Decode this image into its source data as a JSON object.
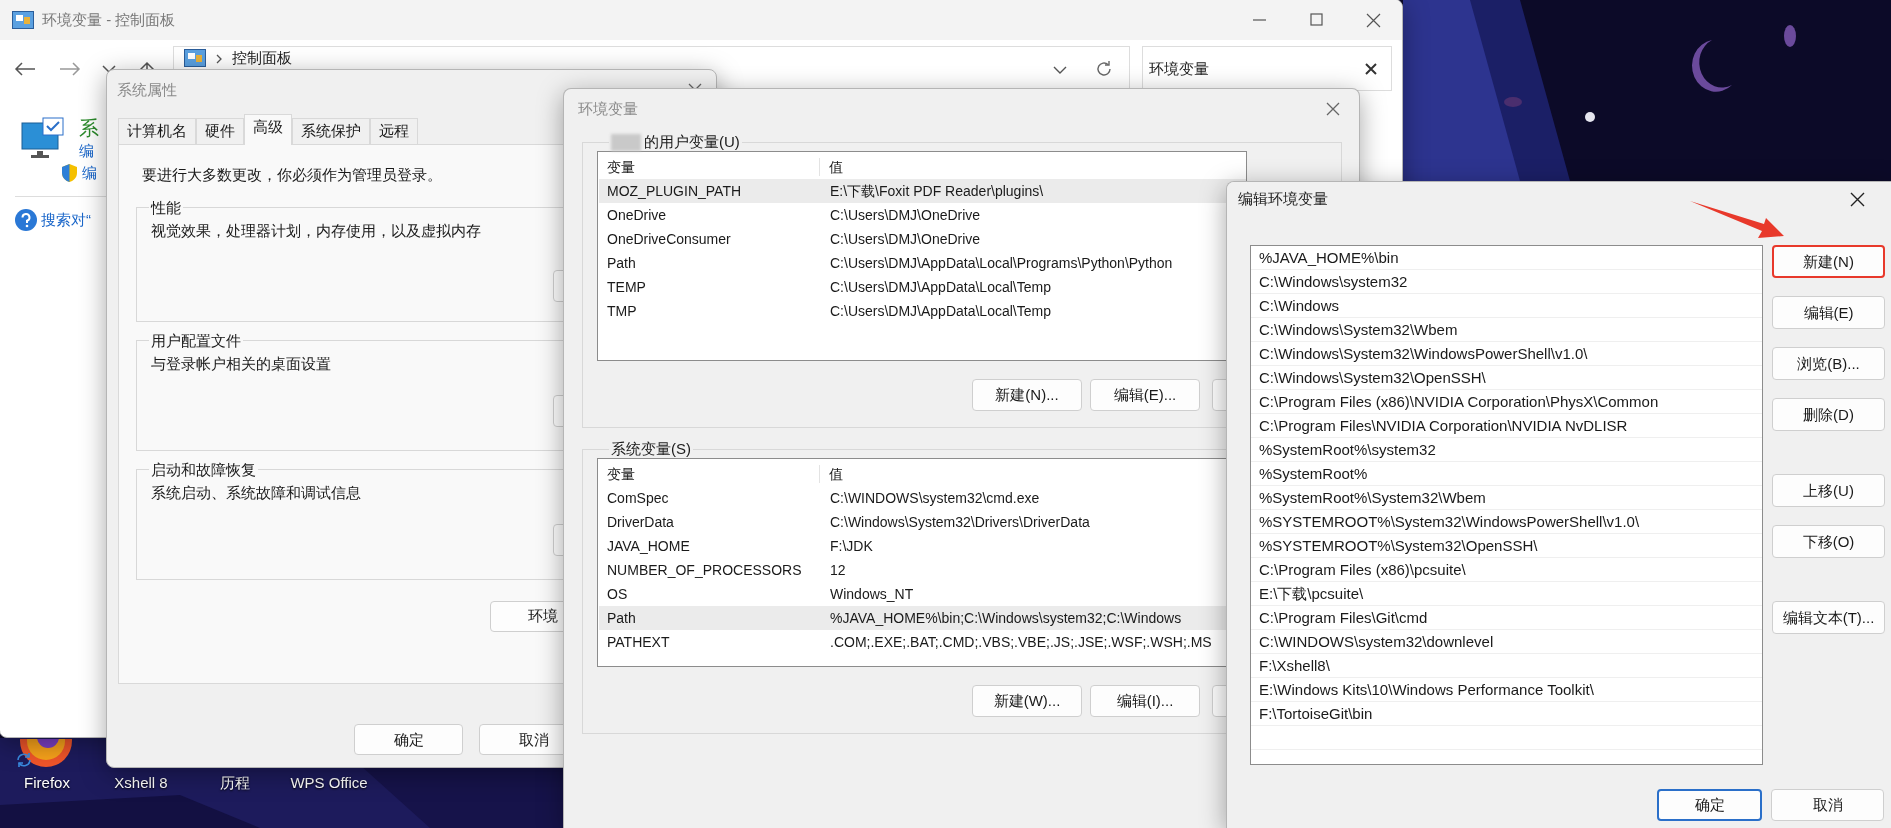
{
  "desktop": {
    "icons": [
      {
        "label": "Firefox"
      },
      {
        "label": "Xshell 8"
      },
      {
        "label": "历程"
      },
      {
        "label": "WPS Office"
      }
    ]
  },
  "control_panel": {
    "title": "环境变量 - 控制面板",
    "breadcrumb": "控制面板",
    "search": {
      "value": "环境变量"
    },
    "side_items": [
      {
        "kind": "title",
        "text": "系"
      },
      {
        "kind": "link",
        "text": "编"
      },
      {
        "kind": "shield_link",
        "text": "编"
      },
      {
        "kind": "help",
        "text": "搜索对“"
      }
    ]
  },
  "system_properties": {
    "title": "系统属性",
    "tabs": [
      {
        "label": "计算机名",
        "selected": false
      },
      {
        "label": "硬件",
        "selected": false
      },
      {
        "label": "高级",
        "selected": true
      },
      {
        "label": "系统保护",
        "selected": false
      },
      {
        "label": "远程",
        "selected": false
      }
    ],
    "notice": "要进行大多数更改，你必须作为管理员登录。",
    "groups": [
      {
        "title": "性能",
        "text": "视觉效果，处理器计划，内存使用，以及虚拟内存"
      },
      {
        "title": "用户配置文件",
        "text": "与登录帐户相关的桌面设置"
      },
      {
        "title": "启动和故障恢复",
        "text": "系统启动、系统故障和调试信息"
      }
    ],
    "env_button": "环境",
    "buttons": [
      "确定",
      "取消"
    ]
  },
  "environment_variables": {
    "title": "环境变量",
    "user_group": "的用户变量(U)",
    "user_table": {
      "columns": [
        "变量",
        "值"
      ],
      "rows": [
        {
          "variable": "MOZ_PLUGIN_PATH",
          "value": "E:\\下载\\Foxit PDF Reader\\plugins\\",
          "selected": true
        },
        {
          "variable": "OneDrive",
          "value": "C:\\Users\\DMJ\\OneDrive",
          "selected": false
        },
        {
          "variable": "OneDriveConsumer",
          "value": "C:\\Users\\DMJ\\OneDrive",
          "selected": false
        },
        {
          "variable": "Path",
          "value": "C:\\Users\\DMJ\\AppData\\Local\\Programs\\Python\\Python",
          "selected": false
        },
        {
          "variable": "TEMP",
          "value": "C:\\Users\\DMJ\\AppData\\Local\\Temp",
          "selected": false
        },
        {
          "variable": "TMP",
          "value": "C:\\Users\\DMJ\\AppData\\Local\\Temp",
          "selected": false
        }
      ]
    },
    "user_buttons": [
      "新建(N)...",
      "编辑(E)..."
    ],
    "system_group": "系统变量(S)",
    "system_table": {
      "columns": [
        "变量",
        "值"
      ],
      "rows": [
        {
          "variable": "ComSpec",
          "value": "C:\\WINDOWS\\system32\\cmd.exe",
          "selected": false
        },
        {
          "variable": "DriverData",
          "value": "C:\\Windows\\System32\\Drivers\\DriverData",
          "selected": false
        },
        {
          "variable": "JAVA_HOME",
          "value": "F:\\JDK",
          "selected": false
        },
        {
          "variable": "NUMBER_OF_PROCESSORS",
          "value": "12",
          "selected": false
        },
        {
          "variable": "OS",
          "value": "Windows_NT",
          "selected": false
        },
        {
          "variable": "Path",
          "value": "%JAVA_HOME%\\bin;C:\\Windows\\system32;C:\\Windows",
          "selected": true
        },
        {
          "variable": "PATHEXT",
          "value": ".COM;.EXE;.BAT;.CMD;.VBS;.VBE;.JS;.JSE;.WSF;.WSH;.MS",
          "selected": false
        }
      ]
    },
    "system_buttons": [
      "新建(W)...",
      "编辑(I)..."
    ]
  },
  "edit_dialog": {
    "title": "编辑环境变量",
    "entries": [
      "%JAVA_HOME%\\bin",
      "C:\\Windows\\system32",
      "C:\\Windows",
      "C:\\Windows\\System32\\Wbem",
      "C:\\Windows\\System32\\WindowsPowerShell\\v1.0\\",
      "C:\\Windows\\System32\\OpenSSH\\",
      "C:\\Program Files (x86)\\NVIDIA Corporation\\PhysX\\Common",
      "C:\\Program Files\\NVIDIA Corporation\\NVIDIA NvDLISR",
      "%SystemRoot%\\system32",
      "%SystemRoot%",
      "%SystemRoot%\\System32\\Wbem",
      "%SYSTEMROOT%\\System32\\WindowsPowerShell\\v1.0\\",
      "%SYSTEMROOT%\\System32\\OpenSSH\\",
      "C:\\Program Files (x86)\\pcsuite\\",
      "E:\\下载\\pcsuite\\",
      "C:\\Program Files\\Git\\cmd",
      "C:\\WINDOWS\\system32\\downlevel",
      "F:\\Xshell8\\",
      "E:\\Windows Kits\\10\\Windows Performance Toolkit\\",
      "F:\\TortoiseGit\\bin"
    ],
    "button_groups": [
      [
        {
          "label": "新建(N)",
          "highlighted": true
        },
        {
          "label": "编辑(E)",
          "highlighted": false
        },
        {
          "label": "浏览(B)...",
          "highlighted": false
        },
        {
          "label": "删除(D)",
          "highlighted": false
        }
      ],
      [
        {
          "label": "上移(U)",
          "highlighted": false
        },
        {
          "label": "下移(O)",
          "highlighted": false
        }
      ],
      [
        {
          "label": "编辑文本(T)...",
          "highlighted": false
        }
      ]
    ],
    "footer_buttons": [
      {
        "label": "确定",
        "default": true
      },
      {
        "label": "取消",
        "default": false
      }
    ]
  }
}
